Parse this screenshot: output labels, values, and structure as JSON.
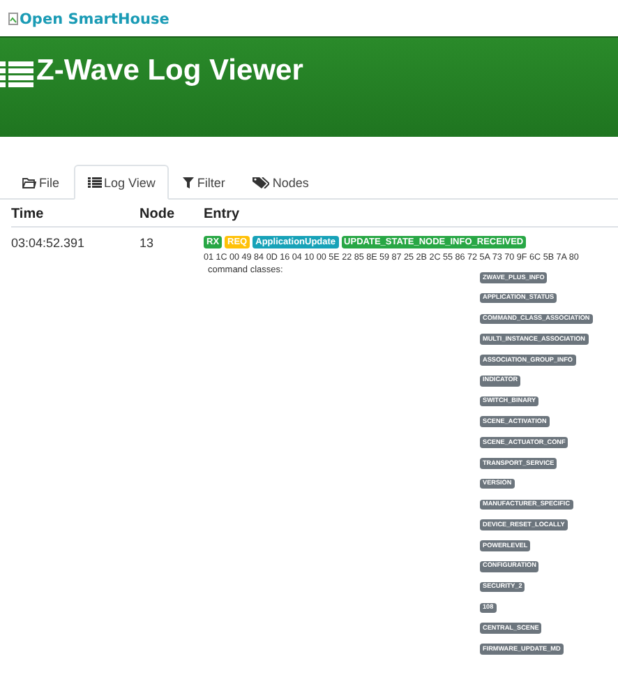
{
  "logo": {
    "alt": "Open SmartHouse"
  },
  "header": {
    "title": "Z-Wave Log Viewer"
  },
  "tabs": [
    {
      "label": "File",
      "selected": false
    },
    {
      "label": "Log View",
      "selected": true
    },
    {
      "label": "Filter",
      "selected": false
    },
    {
      "label": "Nodes",
      "selected": false
    }
  ],
  "table": {
    "columns": [
      "Time",
      "Node",
      "Entry"
    ],
    "rows": [
      {
        "time": "03:04:52.391",
        "node": "13",
        "tags": [
          {
            "label": "RX",
            "color": "#28a745"
          },
          {
            "label": "REQ",
            "color": "#ffc107"
          },
          {
            "label": "ApplicationUpdate",
            "color": "#17a2b8"
          },
          {
            "label": "UPDATE_STATE_NODE_INFO_RECEIVED",
            "color": "#28a745"
          }
        ],
        "bytes": "01 1C 00 49 84 0D 16 04 10 00 5E 22 85 8E 59 87 25 2B 2C 55 86 72 5A 73 70 9F 6C 5B 7A 80",
        "classes_label": "command classes:",
        "classes": [
          "ZWAVE_PLUS_INFO",
          "APPLICATION_STATUS",
          "COMMAND_CLASS_ASSOCIATION",
          "MULTI_INSTANCE_ASSOCIATION",
          "ASSOCIATION_GROUP_INFO",
          "INDICATOR",
          "SWITCH_BINARY",
          "SCENE_ACTIVATION",
          "SCENE_ACTUATOR_CONF",
          "TRANSPORT_SERVICE",
          "VERSION",
          "MANUFACTURER_SPECIFIC",
          "DEVICE_RESET_LOCALLY",
          "POWERLEVEL",
          "CONFIGURATION",
          "SECURITY_2",
          "108",
          "CENTRAL_SCENE",
          "FIRMWARE_UPDATE_MD"
        ]
      }
    ]
  }
}
